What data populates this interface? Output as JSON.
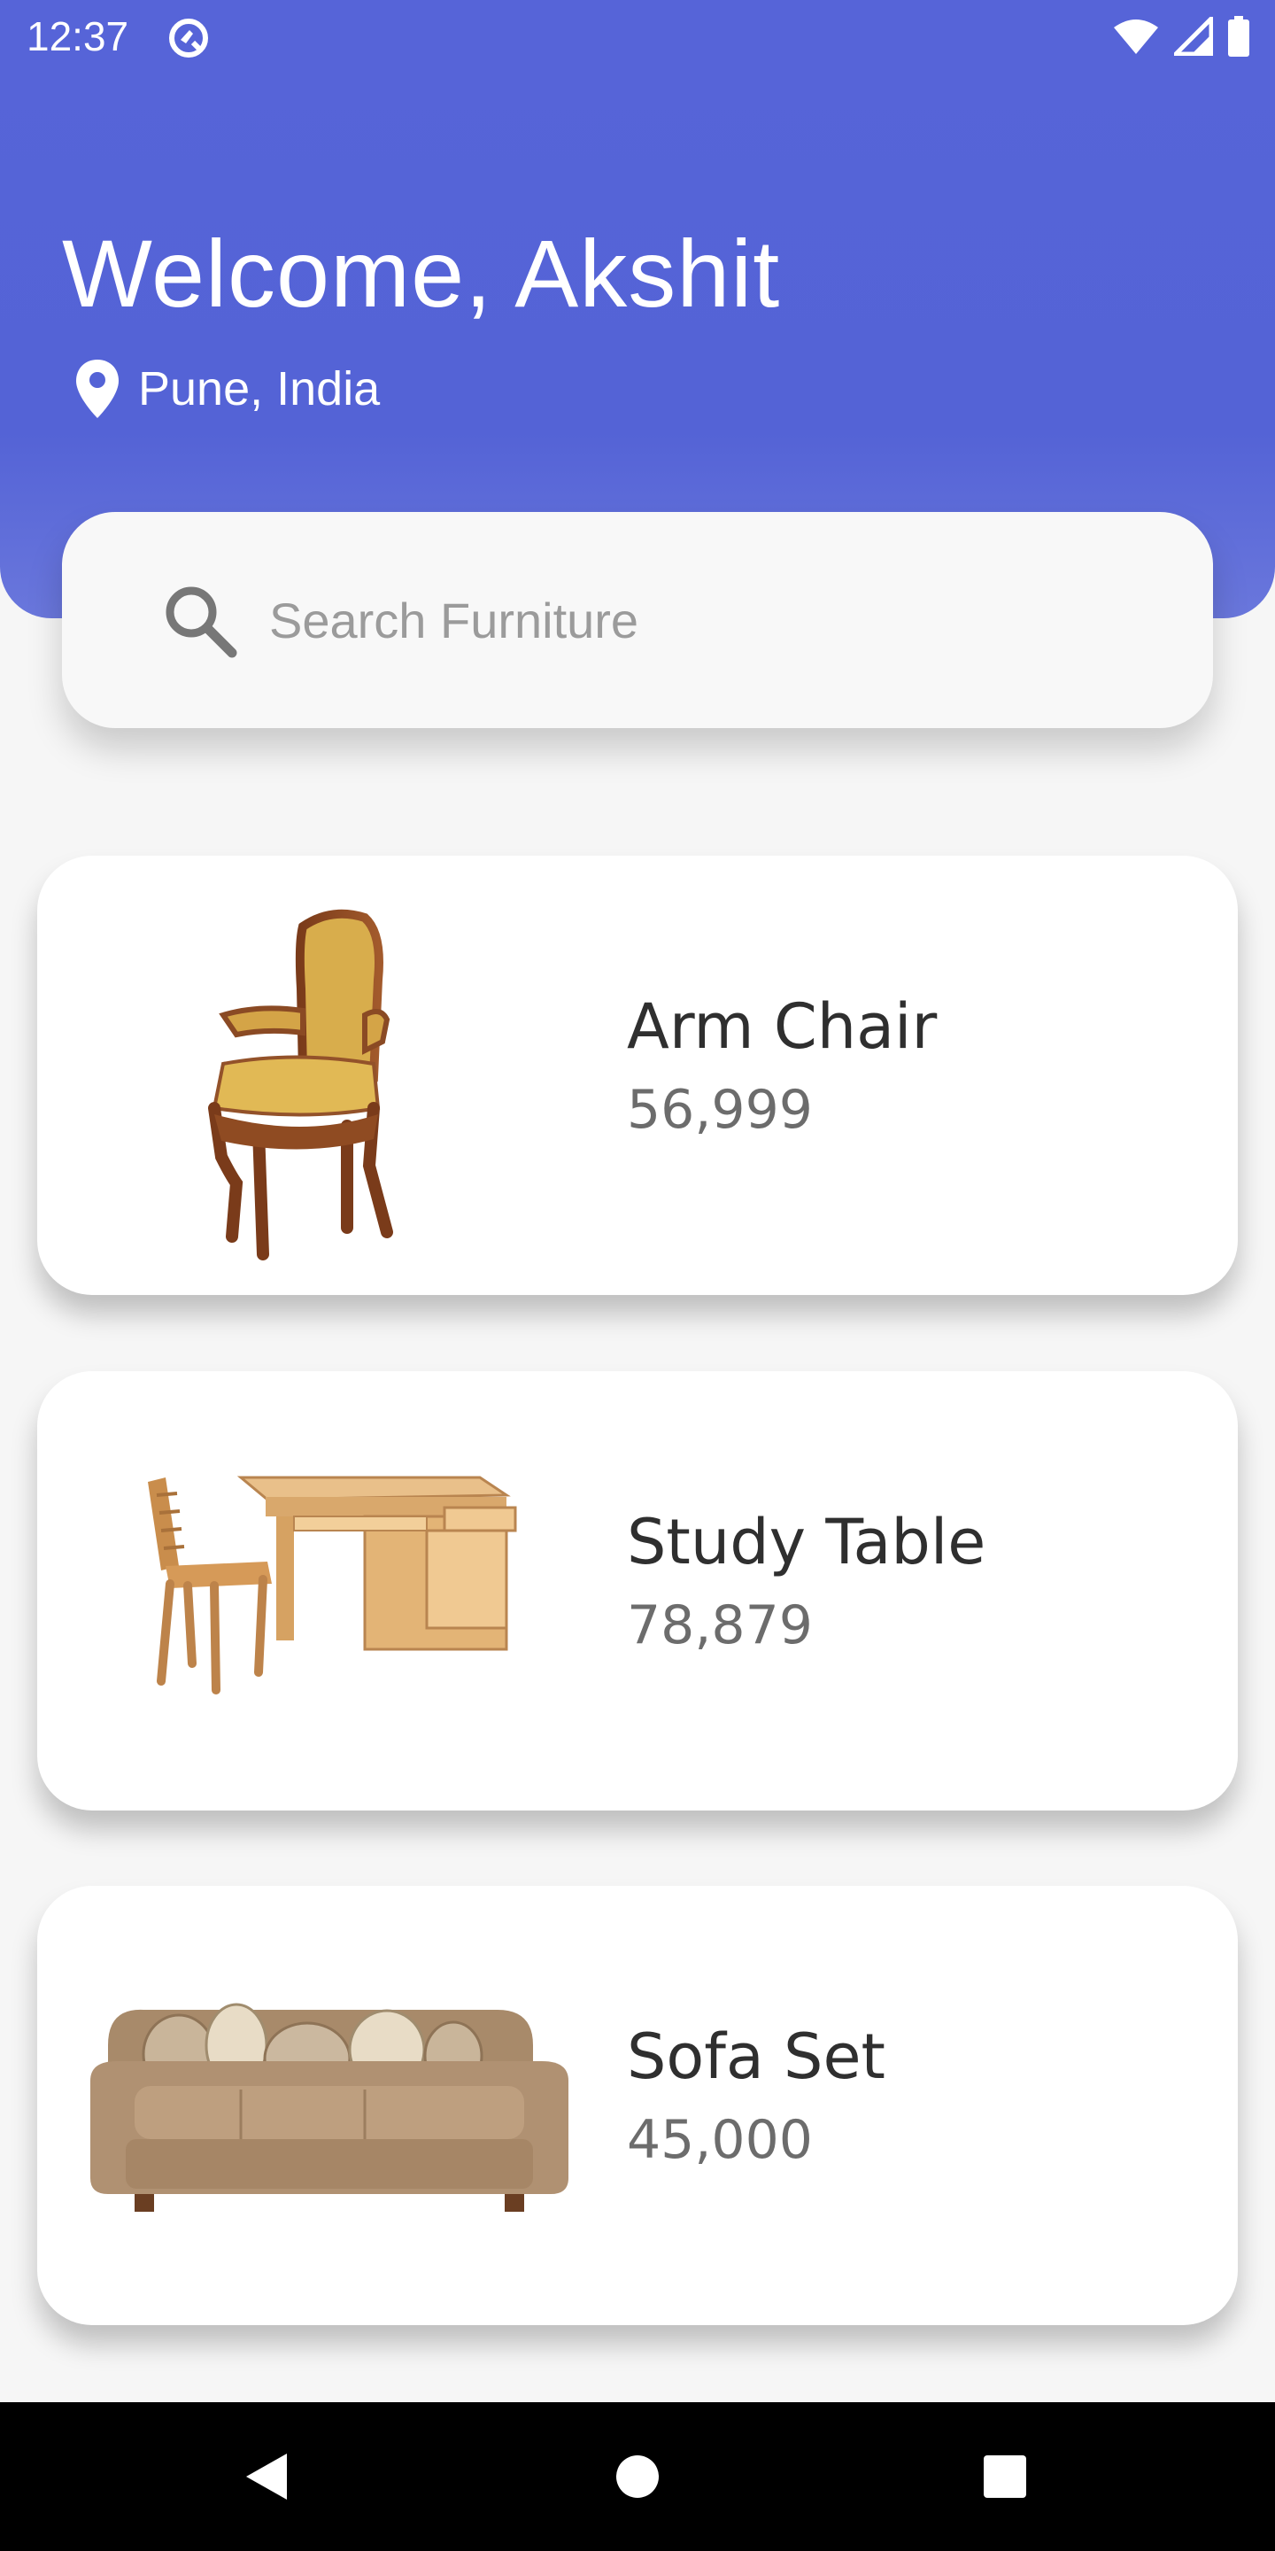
{
  "status": {
    "time": "12:37"
  },
  "header": {
    "welcome": "Welcome, Akshit",
    "location": "Pune, India"
  },
  "search": {
    "placeholder": "Search Furniture"
  },
  "products": [
    {
      "name": "Arm Chair",
      "price": "56,999",
      "image": "arm-chair-image"
    },
    {
      "name": "Study Table",
      "price": "78,879",
      "image": "study-table-image"
    },
    {
      "name": "Sofa Set",
      "price": "45,000",
      "image": "sofa-set-image"
    }
  ],
  "colors": {
    "header": "#5463d6",
    "background": "#f6f6f6",
    "card": "#ffffff",
    "nav": "#000000"
  }
}
